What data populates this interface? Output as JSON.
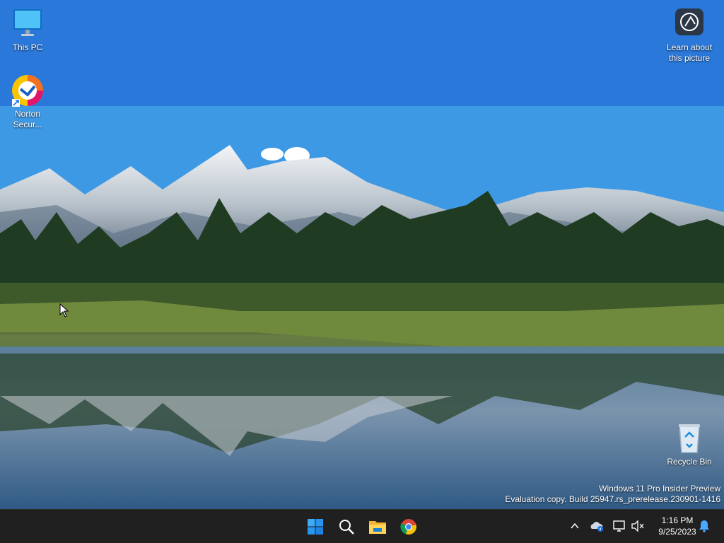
{
  "desktop": {
    "icons": {
      "this_pc": "This PC",
      "norton": "Norton Secur...",
      "learn": "Learn about this picture",
      "recycle_bin": "Recycle Bin"
    },
    "watermark": {
      "line1": "Windows 11 Pro Insider Preview",
      "line2": "Evaluation copy. Build 25947.rs_prerelease.230901-1416"
    }
  },
  "taskbar": {
    "pinned": [
      "start-icon",
      "search-icon",
      "file-explorer-icon",
      "chrome-icon"
    ],
    "tray": [
      "chevron-up-icon",
      "onedrive-icon",
      "network-icon",
      "volume-muted-icon",
      "notification-bell-icon"
    ],
    "clock": {
      "time": "1:16 PM",
      "date": "9/25/2023"
    }
  },
  "colors": {
    "taskbar": "#202020",
    "accent": "#0078d4",
    "sky": "#2c7fde"
  }
}
